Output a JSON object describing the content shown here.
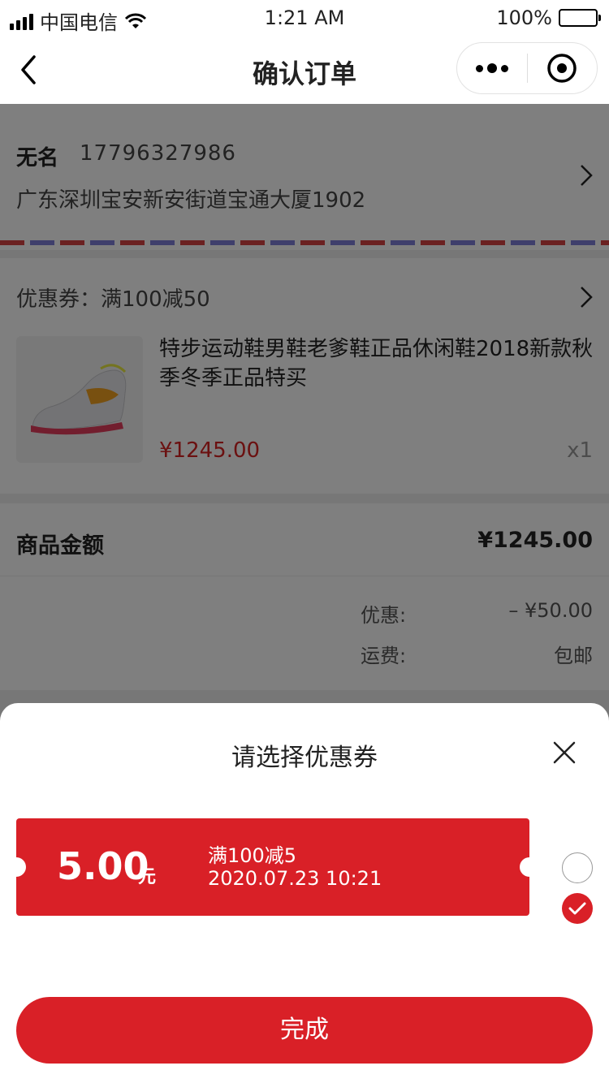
{
  "status_bar": {
    "carrier": "中国电信",
    "time": "1:21 AM",
    "battery": "100%"
  },
  "nav": {
    "title": "确认订单",
    "icons": [
      "back-chevron-icon",
      "more-dots-icon",
      "target-icon"
    ]
  },
  "address": {
    "name": "无名",
    "phone": "17796327986",
    "line": "广东深圳宝安新安街道宝通大厦1902"
  },
  "order": {
    "coupon_row": "优惠券：满100减50",
    "product": {
      "title": "特步运动鞋男鞋老爹鞋正品休闲鞋2018新款秋季冬季正品特买",
      "price": "¥1245.00",
      "qty": "x1"
    }
  },
  "summary": {
    "goods_label": "商品金额",
    "goods_value": "¥1245.00",
    "discount_label": "优惠:",
    "discount_value": "– ¥50.00",
    "shipping_label": "运费:",
    "shipping_value": "包邮"
  },
  "sheet": {
    "title": "请选择优惠券",
    "coupon": {
      "amount": "5.00",
      "unit": "元",
      "name": "满100减5",
      "date": "2020.07.23 10:21"
    },
    "done_label": "完成"
  },
  "colors": {
    "accent": "#d92027",
    "price": "#d62222",
    "stripe_red": "#d64242",
    "stripe_blue": "#7f7fd8"
  }
}
